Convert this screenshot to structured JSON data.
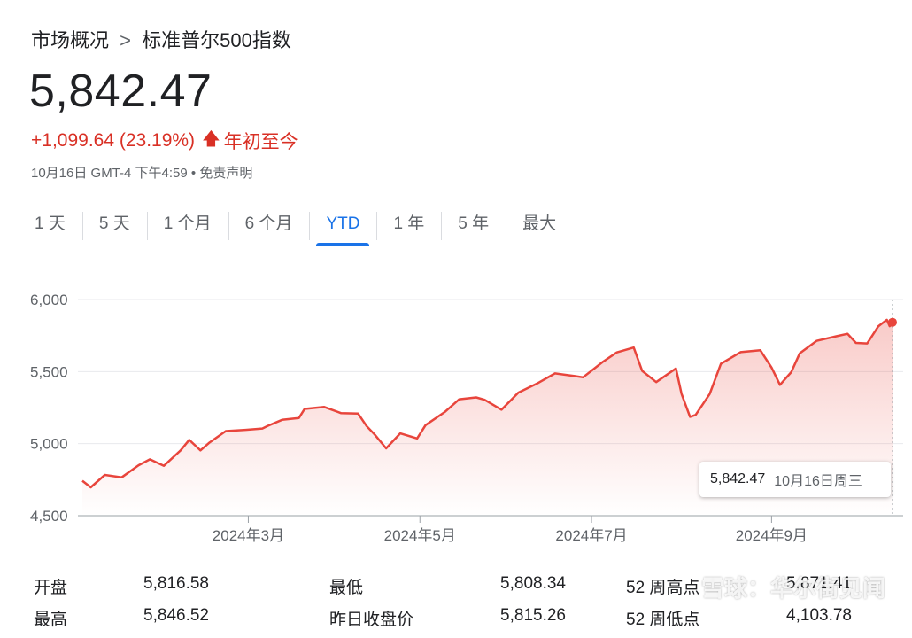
{
  "breadcrumb": {
    "parent": "市场概况",
    "separator": ">",
    "current": "标准普尔500指数"
  },
  "quote": {
    "price": "5,842.47",
    "change": "+1,099.64 (23.19%)",
    "period": "年初至今",
    "meta_time": "10月16日 GMT-4 下午4:59",
    "meta_dot": "•",
    "meta_link": "免责声明"
  },
  "tabs": [
    {
      "label": "1 天"
    },
    {
      "label": "5 天"
    },
    {
      "label": "1 个月"
    },
    {
      "label": "6 个月"
    },
    {
      "label": "YTD",
      "active": true
    },
    {
      "label": "1 年"
    },
    {
      "label": "5 年"
    },
    {
      "label": "最大"
    }
  ],
  "colors": {
    "up": "#d93025",
    "line": "#e8453c",
    "accent": "#1a73e8"
  },
  "tooltip": {
    "value": "5,842.47",
    "date": "10月16日周三"
  },
  "chart_data": {
    "type": "area",
    "title": "",
    "xlabel": "",
    "ylabel": "",
    "ylim": [
      4500,
      6000
    ],
    "y_ticks": [
      "6,000",
      "5,500",
      "5,000",
      "4,500"
    ],
    "y_tick_values": [
      6000,
      5500,
      5000,
      4500
    ],
    "x_ticks": [
      "2024年3月",
      "2024年5月",
      "2024年7月",
      "2024年9月"
    ],
    "x_tick_dates": [
      "2024-03-01",
      "2024-05-01",
      "2024-07-01",
      "2024-09-03"
    ],
    "grid": true,
    "series": [
      {
        "points": [
          [
            "2024-01-02",
            4742
          ],
          [
            "2024-01-05",
            4697
          ],
          [
            "2024-01-10",
            4783
          ],
          [
            "2024-01-16",
            4766
          ],
          [
            "2024-01-22",
            4850
          ],
          [
            "2024-01-26",
            4891
          ],
          [
            "2024-01-31",
            4846
          ],
          [
            "2024-02-06",
            4954
          ],
          [
            "2024-02-09",
            5026
          ],
          [
            "2024-02-13",
            4953
          ],
          [
            "2024-02-16",
            5005
          ],
          [
            "2024-02-22",
            5087
          ],
          [
            "2024-02-29",
            5096
          ],
          [
            "2024-03-06",
            5105
          ],
          [
            "2024-03-08",
            5124
          ],
          [
            "2024-03-13",
            5165
          ],
          [
            "2024-03-19",
            5178
          ],
          [
            "2024-03-21",
            5241
          ],
          [
            "2024-03-28",
            5254
          ],
          [
            "2024-04-03",
            5211
          ],
          [
            "2024-04-09",
            5209
          ],
          [
            "2024-04-12",
            5123
          ],
          [
            "2024-04-15",
            5061
          ],
          [
            "2024-04-19",
            4967
          ],
          [
            "2024-04-24",
            5071
          ],
          [
            "2024-04-30",
            5036
          ],
          [
            "2024-05-03",
            5128
          ],
          [
            "2024-05-10",
            5222
          ],
          [
            "2024-05-15",
            5308
          ],
          [
            "2024-05-21",
            5321
          ],
          [
            "2024-05-24",
            5304
          ],
          [
            "2024-05-30",
            5235
          ],
          [
            "2024-06-05",
            5354
          ],
          [
            "2024-06-12",
            5421
          ],
          [
            "2024-06-18",
            5487
          ],
          [
            "2024-06-25",
            5469
          ],
          [
            "2024-06-28",
            5460
          ],
          [
            "2024-07-05",
            5567
          ],
          [
            "2024-07-10",
            5633
          ],
          [
            "2024-07-16",
            5667
          ],
          [
            "2024-07-19",
            5505
          ],
          [
            "2024-07-24",
            5427
          ],
          [
            "2024-07-31",
            5522
          ],
          [
            "2024-08-02",
            5346
          ],
          [
            "2024-08-05",
            5186
          ],
          [
            "2024-08-07",
            5199
          ],
          [
            "2024-08-12",
            5344
          ],
          [
            "2024-08-16",
            5554
          ],
          [
            "2024-08-23",
            5635
          ],
          [
            "2024-08-30",
            5648
          ],
          [
            "2024-09-03",
            5528
          ],
          [
            "2024-09-06",
            5408
          ],
          [
            "2024-09-10",
            5496
          ],
          [
            "2024-09-13",
            5626
          ],
          [
            "2024-09-19",
            5713
          ],
          [
            "2024-09-26",
            5745
          ],
          [
            "2024-09-30",
            5762
          ],
          [
            "2024-10-03",
            5699
          ],
          [
            "2024-10-07",
            5695
          ],
          [
            "2024-10-11",
            5815
          ],
          [
            "2024-10-14",
            5859
          ],
          [
            "2024-10-15",
            5815
          ],
          [
            "2024-10-16",
            5842
          ]
        ]
      }
    ]
  },
  "stats": [
    {
      "label": "开盘",
      "value": "5,816.58"
    },
    {
      "label": "最低",
      "value": "5,808.34"
    },
    {
      "label": "52 周高点",
      "value": "5,871.41"
    },
    {
      "label": "最高",
      "value": "5,846.52"
    },
    {
      "label": "昨日收盘价",
      "value": "5,815.26"
    },
    {
      "label": "52 周低点",
      "value": "4,103.78"
    }
  ],
  "watermark": "雪球：华尔街见闻"
}
